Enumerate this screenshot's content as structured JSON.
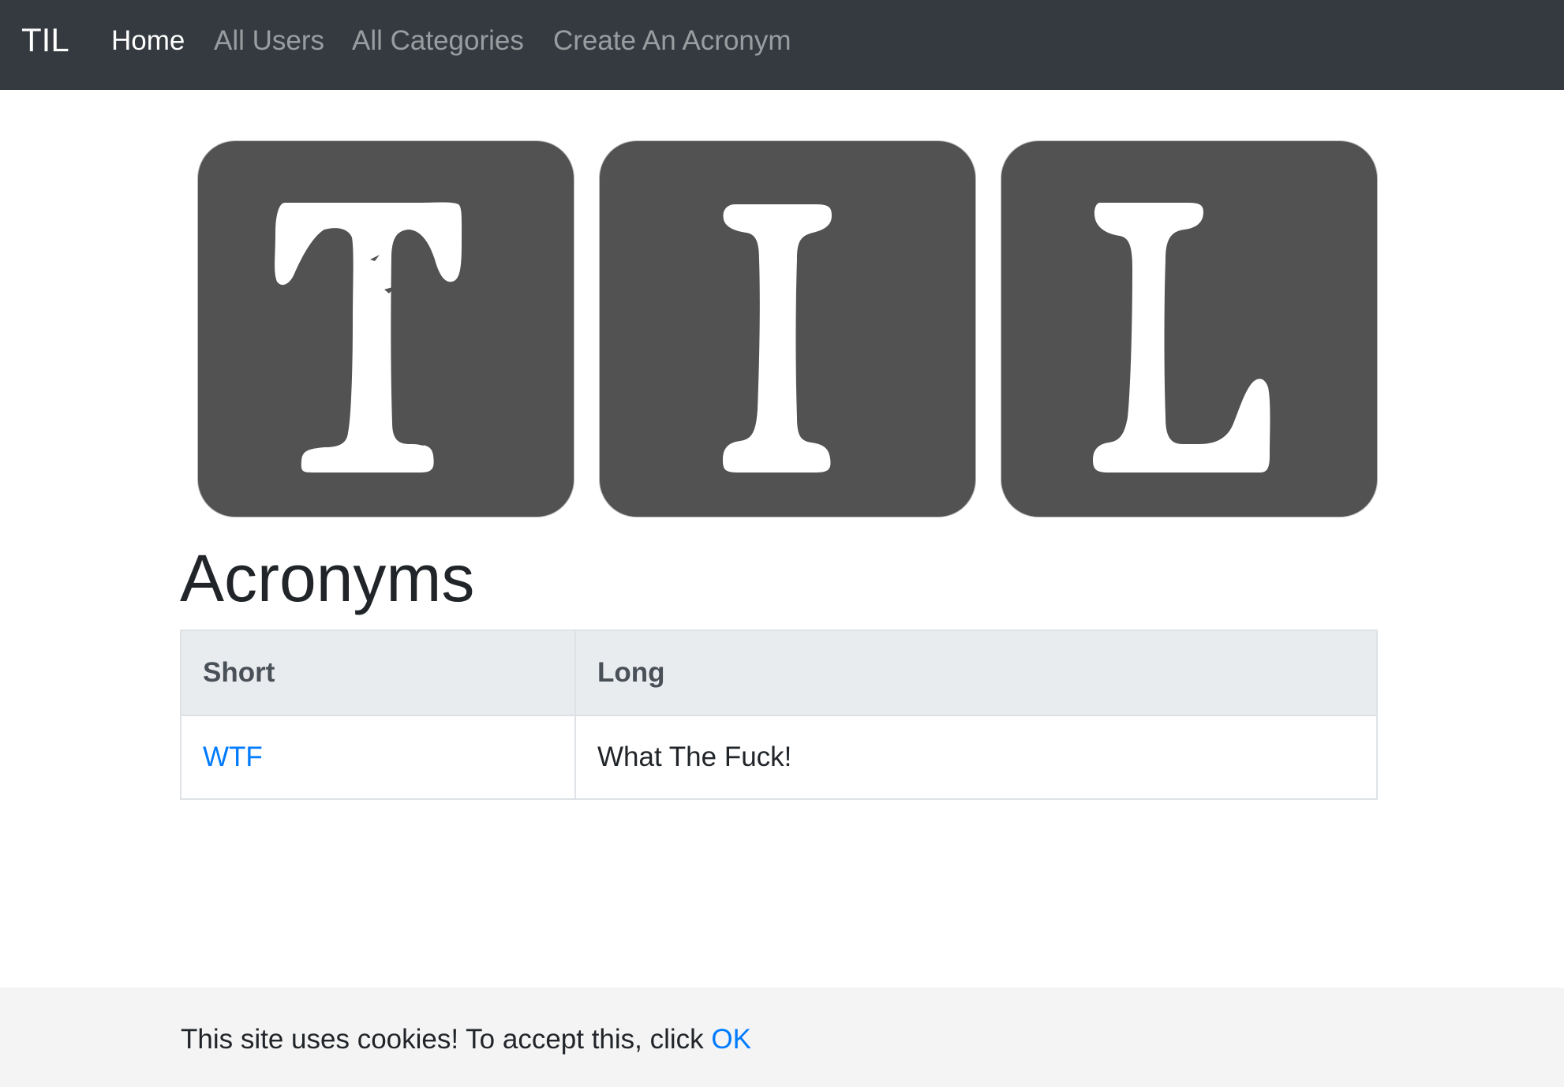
{
  "navbar": {
    "brand": "TIL",
    "background": "#343a40",
    "links": [
      {
        "label": "Home",
        "active": true
      },
      {
        "label": "All Users",
        "active": false
      },
      {
        "label": "All Categories",
        "active": false
      },
      {
        "label": "Create An Acronym",
        "active": false
      }
    ]
  },
  "logo": {
    "letters": [
      "T",
      "I",
      "L"
    ],
    "tile_color": "#525252"
  },
  "main": {
    "title": "Acronyms",
    "table": {
      "headers": [
        "Short",
        "Long"
      ],
      "rows": [
        {
          "short": "WTF",
          "long": "What The Fuck!"
        }
      ]
    }
  },
  "cookie": {
    "message": "This site uses cookies! To accept this, click",
    "ok_label": "OK"
  },
  "colors": {
    "link": "#007bff",
    "table_header_bg": "#e9ecef",
    "cookie_bg": "#f4f4f4"
  }
}
